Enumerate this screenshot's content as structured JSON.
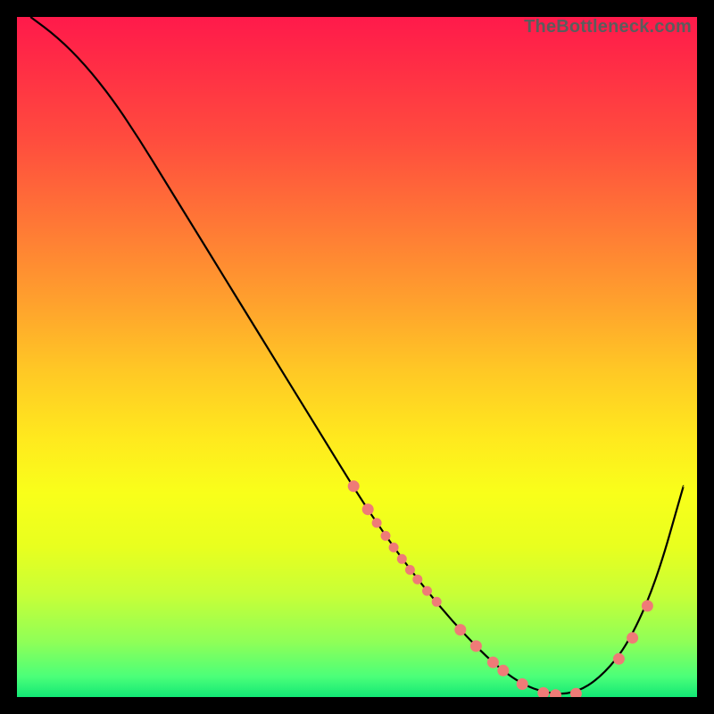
{
  "watermark": "TheBottleneck.com",
  "chart_data": {
    "type": "line",
    "title": "",
    "xlabel": "",
    "ylabel": "",
    "xlim": [
      0,
      100
    ],
    "ylim": [
      0,
      100
    ],
    "x": [
      2,
      6,
      10,
      14,
      18,
      22,
      26,
      30,
      34,
      38,
      42,
      46,
      50,
      54,
      58,
      62,
      66,
      70,
      74,
      78,
      82,
      86,
      90,
      94,
      98
    ],
    "y": [
      100,
      97,
      93,
      88,
      82,
      75.5,
      69,
      62.5,
      56,
      49.5,
      43,
      36.5,
      30,
      24,
      18.5,
      13.5,
      9,
      5,
      2,
      0.5,
      0.5,
      3,
      8,
      17,
      31
    ],
    "markers": [
      {
        "x": 49.5,
        "y": 31.0,
        "r": 6
      },
      {
        "x": 51.6,
        "y": 27.6,
        "r": 6
      },
      {
        "x": 52.9,
        "y": 25.6,
        "r": 5
      },
      {
        "x": 54.2,
        "y": 23.7,
        "r": 5
      },
      {
        "x": 55.4,
        "y": 22.0,
        "r": 5
      },
      {
        "x": 56.6,
        "y": 20.3,
        "r": 5
      },
      {
        "x": 57.8,
        "y": 18.7,
        "r": 5
      },
      {
        "x": 58.9,
        "y": 17.3,
        "r": 5
      },
      {
        "x": 60.3,
        "y": 15.6,
        "r": 5
      },
      {
        "x": 61.7,
        "y": 14.0,
        "r": 5
      },
      {
        "x": 65.2,
        "y": 9.9,
        "r": 6
      },
      {
        "x": 67.5,
        "y": 7.5,
        "r": 6
      },
      {
        "x": 70.0,
        "y": 5.1,
        "r": 6
      },
      {
        "x": 71.5,
        "y": 3.9,
        "r": 6
      },
      {
        "x": 74.3,
        "y": 1.9,
        "r": 6
      },
      {
        "x": 77.4,
        "y": 0.6,
        "r": 6
      },
      {
        "x": 79.2,
        "y": 0.3,
        "r": 6
      },
      {
        "x": 82.2,
        "y": 0.5,
        "r": 6
      },
      {
        "x": 88.5,
        "y": 5.6,
        "r": 6
      },
      {
        "x": 90.5,
        "y": 8.7,
        "r": 6
      },
      {
        "x": 92.7,
        "y": 13.4,
        "r": 6
      }
    ],
    "colors": {
      "curve": "#000000",
      "marker_fill": "#ef7b77",
      "marker_stroke": "#ef7b77"
    }
  }
}
